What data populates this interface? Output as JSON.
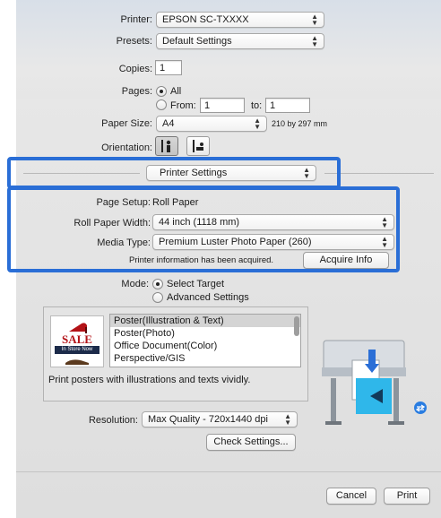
{
  "printer": {
    "label": "Printer:",
    "value": "EPSON SC-TXXXX"
  },
  "presets": {
    "label": "Presets:",
    "value": "Default Settings"
  },
  "copies": {
    "label": "Copies:",
    "value": "1"
  },
  "pages": {
    "label": "Pages:",
    "all_label": "All",
    "from_label": "From:",
    "from_value": "1",
    "to_label": "to:",
    "to_value": "1"
  },
  "paper_size": {
    "label": "Paper Size:",
    "value": "A4",
    "dimensions": "210 by 297 mm"
  },
  "orientation": {
    "label": "Orientation:"
  },
  "section_popup": {
    "value": "Printer Settings"
  },
  "page_setup": {
    "label": "Page Setup:",
    "value": "Roll Paper"
  },
  "roll_paper_width": {
    "label": "Roll Paper Width:",
    "value": "44 inch (1118 mm)"
  },
  "media_type": {
    "label": "Media Type:",
    "value": "Premium Luster Photo Paper (260)"
  },
  "printer_info": {
    "status": "Printer information has been acquired.",
    "acquire_button": "Acquire Info"
  },
  "mode": {
    "label": "Mode:",
    "select_target": "Select Target",
    "advanced": "Advanced Settings"
  },
  "targets": {
    "badge_sale": "SALE",
    "badge_store": "In Store Now",
    "items": [
      "Poster(Illustration & Text)",
      "Poster(Photo)",
      "Office Document(Color)",
      "Perspective/GIS"
    ],
    "description": "Print posters with illustrations and texts vividly."
  },
  "resolution": {
    "label": "Resolution:",
    "value": "Max Quality - 720x1440 dpi"
  },
  "check_settings": "Check Settings...",
  "footer": {
    "cancel": "Cancel",
    "print": "Print"
  },
  "colors": {
    "highlight": "#2a6ed6",
    "selection": "#d4d4d4"
  }
}
